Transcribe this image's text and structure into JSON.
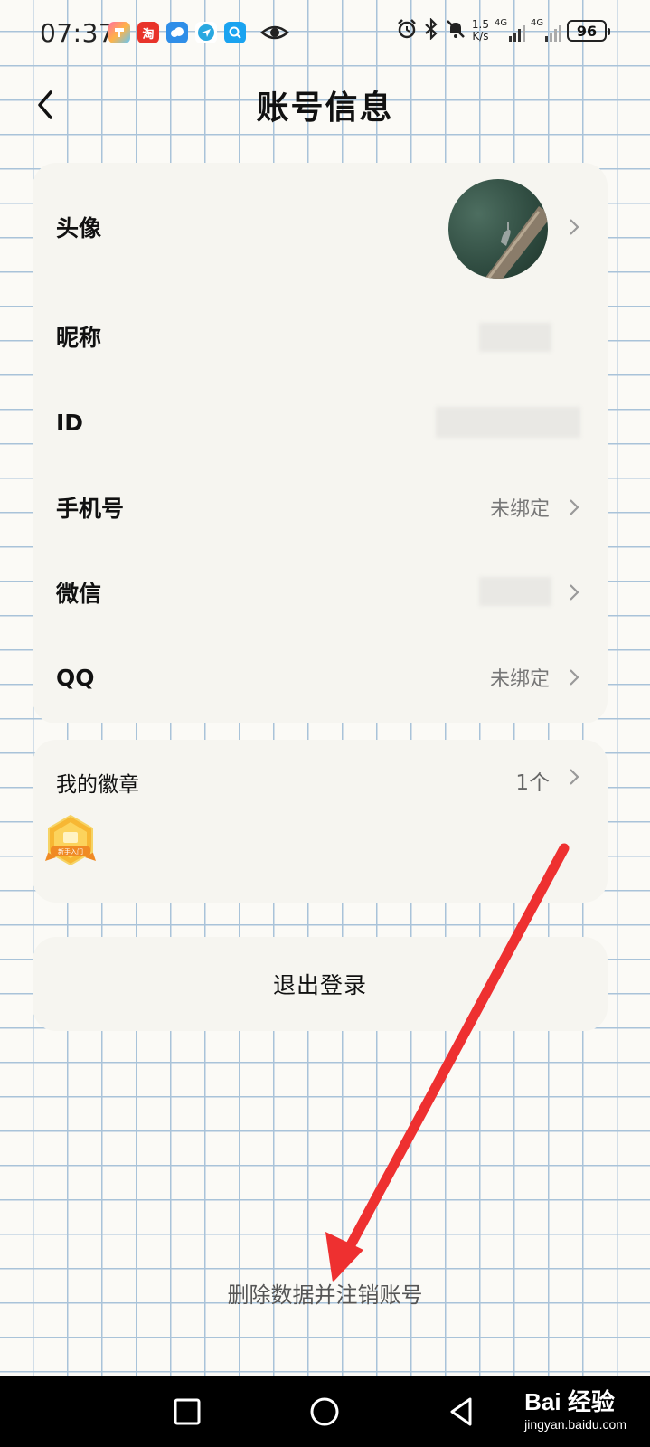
{
  "status_bar": {
    "time": "07:37",
    "net_speed_top": "1.5",
    "net_speed_bottom": "K/s",
    "network_1": "4G",
    "network_2": "4G",
    "battery": "96",
    "app_icons": [
      "notes-app-icon",
      "taobao-app-icon",
      "weather-app-icon",
      "messenger-app-icon",
      "search-app-icon"
    ],
    "status_icons": [
      "alarm-icon",
      "bluetooth-icon",
      "silent-bell-icon"
    ]
  },
  "header": {
    "title": "账号信息"
  },
  "account": {
    "rows": [
      {
        "label": "头像",
        "value": ""
      },
      {
        "label": "昵称",
        "value": ""
      },
      {
        "label": "ID",
        "value": ""
      },
      {
        "label": "手机号",
        "value": "未绑定"
      },
      {
        "label": "微信",
        "value": ""
      },
      {
        "label": "QQ",
        "value": "未绑定"
      }
    ]
  },
  "badges": {
    "title": "我的徽章",
    "count": "1个",
    "badge_text": "新手入门"
  },
  "logout": {
    "label": "退出登录"
  },
  "delete_account": {
    "label": "删除数据并注销账号"
  },
  "annotation": {
    "arrow_color": "#ee3030"
  },
  "watermark": {
    "brand": "Bai 经验",
    "url": "jingyan.baidu.com"
  }
}
